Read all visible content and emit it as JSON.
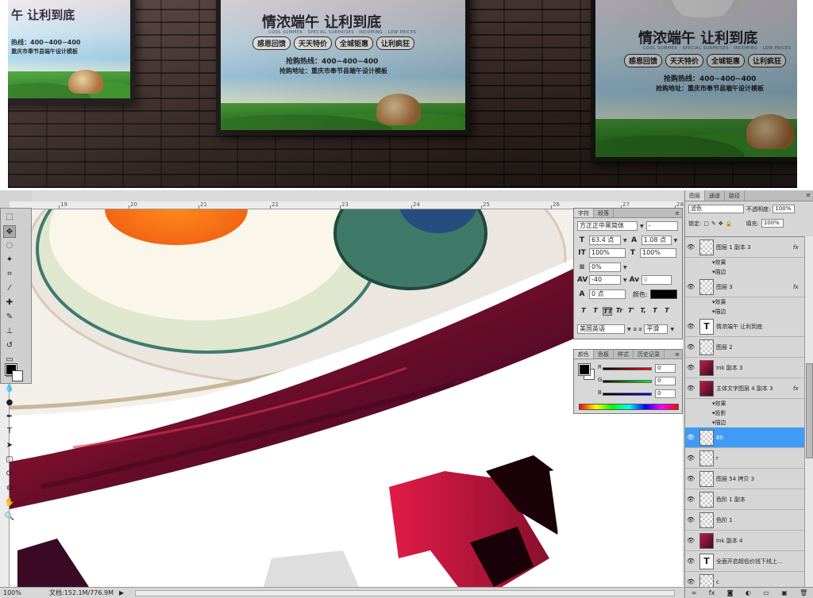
{
  "mockup": {
    "posters": [
      {
        "headline": "午 让利到底",
        "hotline": "热线：400~400~400",
        "addr": "重庆市奉节县端午设计模板"
      },
      {
        "headline": "情浓端午 让利到底",
        "sub": "COOL SUMMER · SPECIAL SURPRISES · INCOMING · LOW PRICES",
        "tags": [
          "感恩回馈",
          "天天特价",
          "全城钜惠",
          "让利疯狂"
        ],
        "hotline": "抢购热线：400~400~400",
        "addr": "抢购地址：重庆市奉节县端午设计模板"
      },
      {
        "headline": "情浓端午 让利到底",
        "sub": "COOL SUMMER · SPECIAL SURPRISES · INCOMING · LOW PRICES",
        "tags": [
          "感恩回馈",
          "天天特价",
          "全城钜惠",
          "让利疯狂"
        ],
        "hotline": "抢购热线：400~400~400",
        "addr": "抢购地址：重庆市奉节县端午设计模板"
      }
    ]
  },
  "ruler": {
    "ticks": [
      "19",
      "20",
      "21",
      "22",
      "23",
      "24",
      "25",
      "26",
      "27",
      "28"
    ]
  },
  "statusbar": {
    "zoom": "100%",
    "doc_info": "文档:152.1M/776.9M"
  },
  "character_panel": {
    "tabs": [
      "字符",
      "段落"
    ],
    "font_family": "方正正中黑简体",
    "font_style": "-",
    "size": "63.4 点",
    "leading": "1.08 点",
    "vscale": "100%",
    "hscale": "100%",
    "kerning": "0%",
    "tracking": "-40",
    "baseline": "0",
    "shift": "0 点",
    "color_label": "颜色:",
    "language": "美国英语",
    "aa_label": "a a",
    "antialias": "平滑",
    "text_buttons": [
      "T",
      "T",
      "TT",
      "Tr",
      "T'",
      "T,",
      "T",
      "T"
    ]
  },
  "color_panel": {
    "tabs": [
      "颜色",
      "色板",
      "样式",
      "历史记录"
    ],
    "channels": [
      {
        "label": "R",
        "value": "0",
        "gradient": "#ff0000"
      },
      {
        "label": "G",
        "value": "0",
        "gradient": "#00ff00"
      },
      {
        "label": "B",
        "value": "0",
        "gradient": "#0000ff"
      }
    ]
  },
  "layers_panel": {
    "tabs": [
      "图层",
      "通道",
      "路径"
    ],
    "blend_mode": "滤色",
    "opacity_label": "不透明度:",
    "opacity": "100%",
    "lock_label": "锁定:",
    "fill_label": "填充:",
    "fill": "100%",
    "layers": [
      {
        "kind": "layer",
        "name": "图层 1 副本 3",
        "thumb": "",
        "fx": "fx"
      },
      {
        "kind": "sub",
        "name": "效果"
      },
      {
        "kind": "sub",
        "name": "描边"
      },
      {
        "kind": "layer",
        "name": "图层 3",
        "thumb": "",
        "fx": "fx"
      },
      {
        "kind": "sub",
        "name": "效果"
      },
      {
        "kind": "sub",
        "name": "描边"
      },
      {
        "kind": "layer",
        "name": "情浓端午 让利到底",
        "thumb": "T",
        "fx": ""
      },
      {
        "kind": "layer",
        "name": "图层 2",
        "thumb": "",
        "fx": ""
      },
      {
        "kind": "layer",
        "name": "Ink 副本 3",
        "thumb": "ink",
        "fx": ""
      },
      {
        "kind": "layer",
        "name": "主体文字图层 4 副本 3",
        "thumb": "ink",
        "fx": "fx"
      },
      {
        "kind": "sub",
        "name": "效果"
      },
      {
        "kind": "sub",
        "name": "投影"
      },
      {
        "kind": "sub",
        "name": "描边"
      },
      {
        "kind": "layer",
        "name": "80",
        "thumb": "",
        "fx": "",
        "selected": true
      },
      {
        "kind": "layer",
        "name": "r",
        "thumb": "",
        "fx": ""
      },
      {
        "kind": "layer",
        "name": "图层 54 拷贝 3",
        "thumb": "",
        "fx": ""
      },
      {
        "kind": "layer",
        "name": "色阶 1 副本",
        "thumb": "",
        "fx": ""
      },
      {
        "kind": "layer",
        "name": "色阶 1",
        "thumb": "",
        "fx": ""
      },
      {
        "kind": "layer",
        "name": "Ink 副本 4",
        "thumb": "ink",
        "fx": ""
      },
      {
        "kind": "layer",
        "name": "全面开启超低价钱下线上...",
        "thumb": "T",
        "fx": ""
      },
      {
        "kind": "layer",
        "name": "c",
        "thumb": "",
        "fx": ""
      }
    ]
  },
  "colors": {
    "selected_layer": "#3f9bf4",
    "ink_red": "#c31d3b",
    "ink_dark": "#3a0b2a"
  }
}
